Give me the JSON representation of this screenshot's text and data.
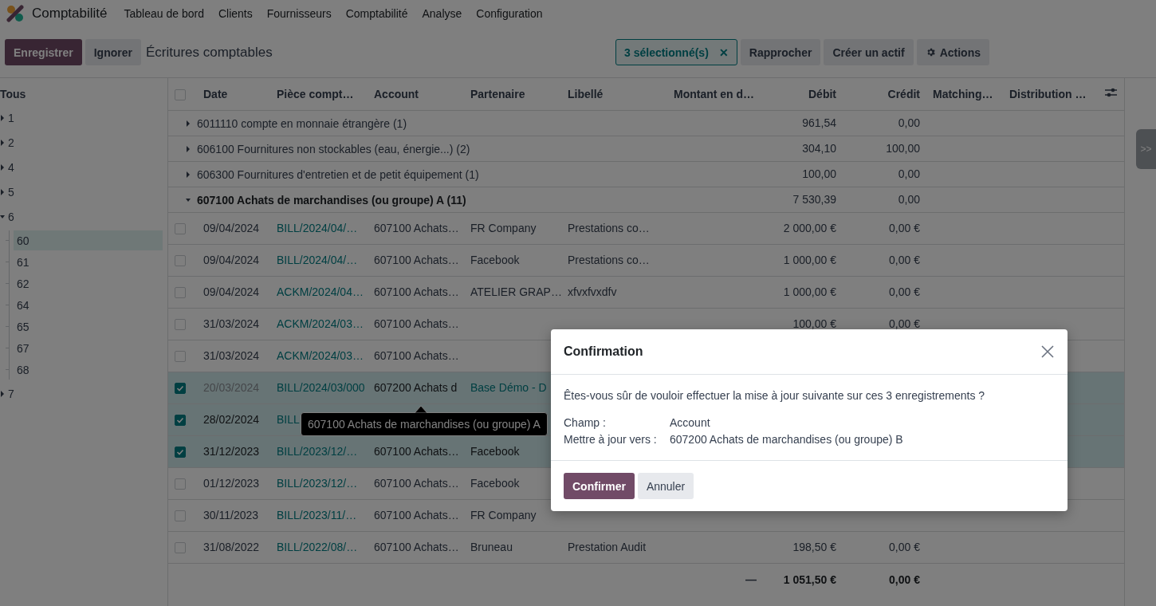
{
  "app": {
    "name": "Comptabilité"
  },
  "menu": [
    "Tableau de bord",
    "Clients",
    "Fournisseurs",
    "Comptabilité",
    "Analyse",
    "Configuration"
  ],
  "toolbar": {
    "save": "Enregistrer",
    "discard": "Ignorer",
    "title": "Écritures comptables",
    "selection": "3 sélectionné(s)",
    "selection_clear": "✕",
    "buttons": [
      "Rapprocher",
      "Créer un actif"
    ],
    "actions": "Actions"
  },
  "sidebar": {
    "root": "Tous",
    "items": [
      {
        "label": "1",
        "expanded": false
      },
      {
        "label": "2",
        "expanded": false
      },
      {
        "label": "4",
        "expanded": false
      },
      {
        "label": "5",
        "expanded": false
      },
      {
        "label": "6",
        "expanded": true,
        "children": [
          {
            "label": "60",
            "selected": true
          },
          {
            "label": "61",
            "selected": false
          },
          {
            "label": "62",
            "selected": false
          },
          {
            "label": "64",
            "selected": false
          },
          {
            "label": "65",
            "selected": false
          },
          {
            "label": "67",
            "selected": false
          },
          {
            "label": "68",
            "selected": false
          }
        ]
      },
      {
        "label": "7",
        "expanded": false
      }
    ]
  },
  "table": {
    "all_selected": false,
    "columns": [
      "Date",
      "Pièce compt…",
      "Account",
      "Partenaire",
      "Libellé",
      "Montant en d…",
      "Débit",
      "Crédit",
      "Matching…",
      "Distribution …"
    ],
    "groups": [
      {
        "label": "6011110 compte en monnaie étrangère (1)",
        "debit": "961,54",
        "credit": "0,00",
        "expanded": false
      },
      {
        "label": "606100 Fournitures non stockables (eau, énergie...) (2)",
        "debit": "304,10",
        "credit": "100,00",
        "expanded": false
      },
      {
        "label": "606300 Fournitures d'entretien et de petit équipement (1)",
        "debit": "100,00",
        "credit": "0,00",
        "expanded": false
      },
      {
        "label": "607100 Achats de marchandises (ou groupe) A (11)",
        "debit": "7 530,39",
        "credit": "0,00",
        "expanded": true
      }
    ],
    "rows": [
      {
        "selected": false,
        "editing": false,
        "date": "09/04/2024",
        "piece": "BILL/2024/04/…",
        "account": "607100 Achats…",
        "partner": "FR Company",
        "label": "Prestations co…",
        "debit": "2 000,00 €",
        "credit": "0,00 €"
      },
      {
        "selected": false,
        "editing": false,
        "date": "09/04/2024",
        "piece": "BILL/2024/04/…",
        "account": "607100 Achats…",
        "partner": "Facebook",
        "label": "Prestations co…",
        "debit": "1 000,00 €",
        "credit": "0,00 €"
      },
      {
        "selected": false,
        "editing": false,
        "date": "09/04/2024",
        "piece": "ACKM/2024/04…",
        "account": "607100 Achats…",
        "partner": "ATELIER GRAP…",
        "label": "xfvxfvxdfv",
        "debit": "1 000,00 €",
        "credit": "0,00 €"
      },
      {
        "selected": false,
        "editing": false,
        "date": "31/03/2024",
        "piece": "ACKM/2024/03…",
        "account": "607100 Achats…",
        "debit": "100,00 €",
        "credit": "0,00 €"
      },
      {
        "selected": false,
        "editing": false,
        "date": "31/03/2024",
        "piece": "ACKM/2024/03…",
        "account": "607100 Achats…"
      },
      {
        "selected": true,
        "editing": true,
        "date": "20/03/2024",
        "piece": "BILL/2024/03/000",
        "account": "607200 Achats d",
        "partner": "Base Démo - D"
      },
      {
        "selected": true,
        "editing": false,
        "date": "28/02/2024",
        "piece": "BILL"
      },
      {
        "selected": true,
        "editing": false,
        "date": "31/12/2023",
        "piece": "BILL/2023/12/…",
        "account": "607100 Achats…",
        "partner": "Facebook"
      },
      {
        "selected": false,
        "editing": false,
        "date": "01/12/2023",
        "piece": "BILL/2023/12/…",
        "account": "607100 Achats…",
        "partner": "Facebook"
      },
      {
        "selected": false,
        "editing": false,
        "date": "30/11/2023",
        "piece": "BILL/2023/11/…",
        "account": "607100 Achats…",
        "partner": "FR Company"
      },
      {
        "selected": false,
        "editing": false,
        "date": "31/08/2022",
        "piece": "BILL/2022/08/…",
        "account": "607100 Achats…",
        "partner": "Bruneau",
        "label": "Prestation Audit",
        "debit": "198,50 €",
        "credit": "0,00 €"
      }
    ],
    "totals": {
      "amount": "—",
      "debit": "1 051,50 €",
      "credit": "0,00 €"
    }
  },
  "side_toggle": ">>",
  "tooltip": "607100 Achats de marchandises (ou groupe) A",
  "dialog": {
    "title": "Confirmation",
    "message": "Êtes-vous sûr de vouloir effectuer la mise à jour suivante sur ces 3 enregistrements ?",
    "fields": [
      {
        "name": "Champ :",
        "value": "Account"
      },
      {
        "name": "Mettre à jour vers :",
        "value": "607200 Achats de marchandises (ou groupe) B"
      }
    ],
    "confirm": "Confirmer",
    "cancel": "Annuler"
  }
}
